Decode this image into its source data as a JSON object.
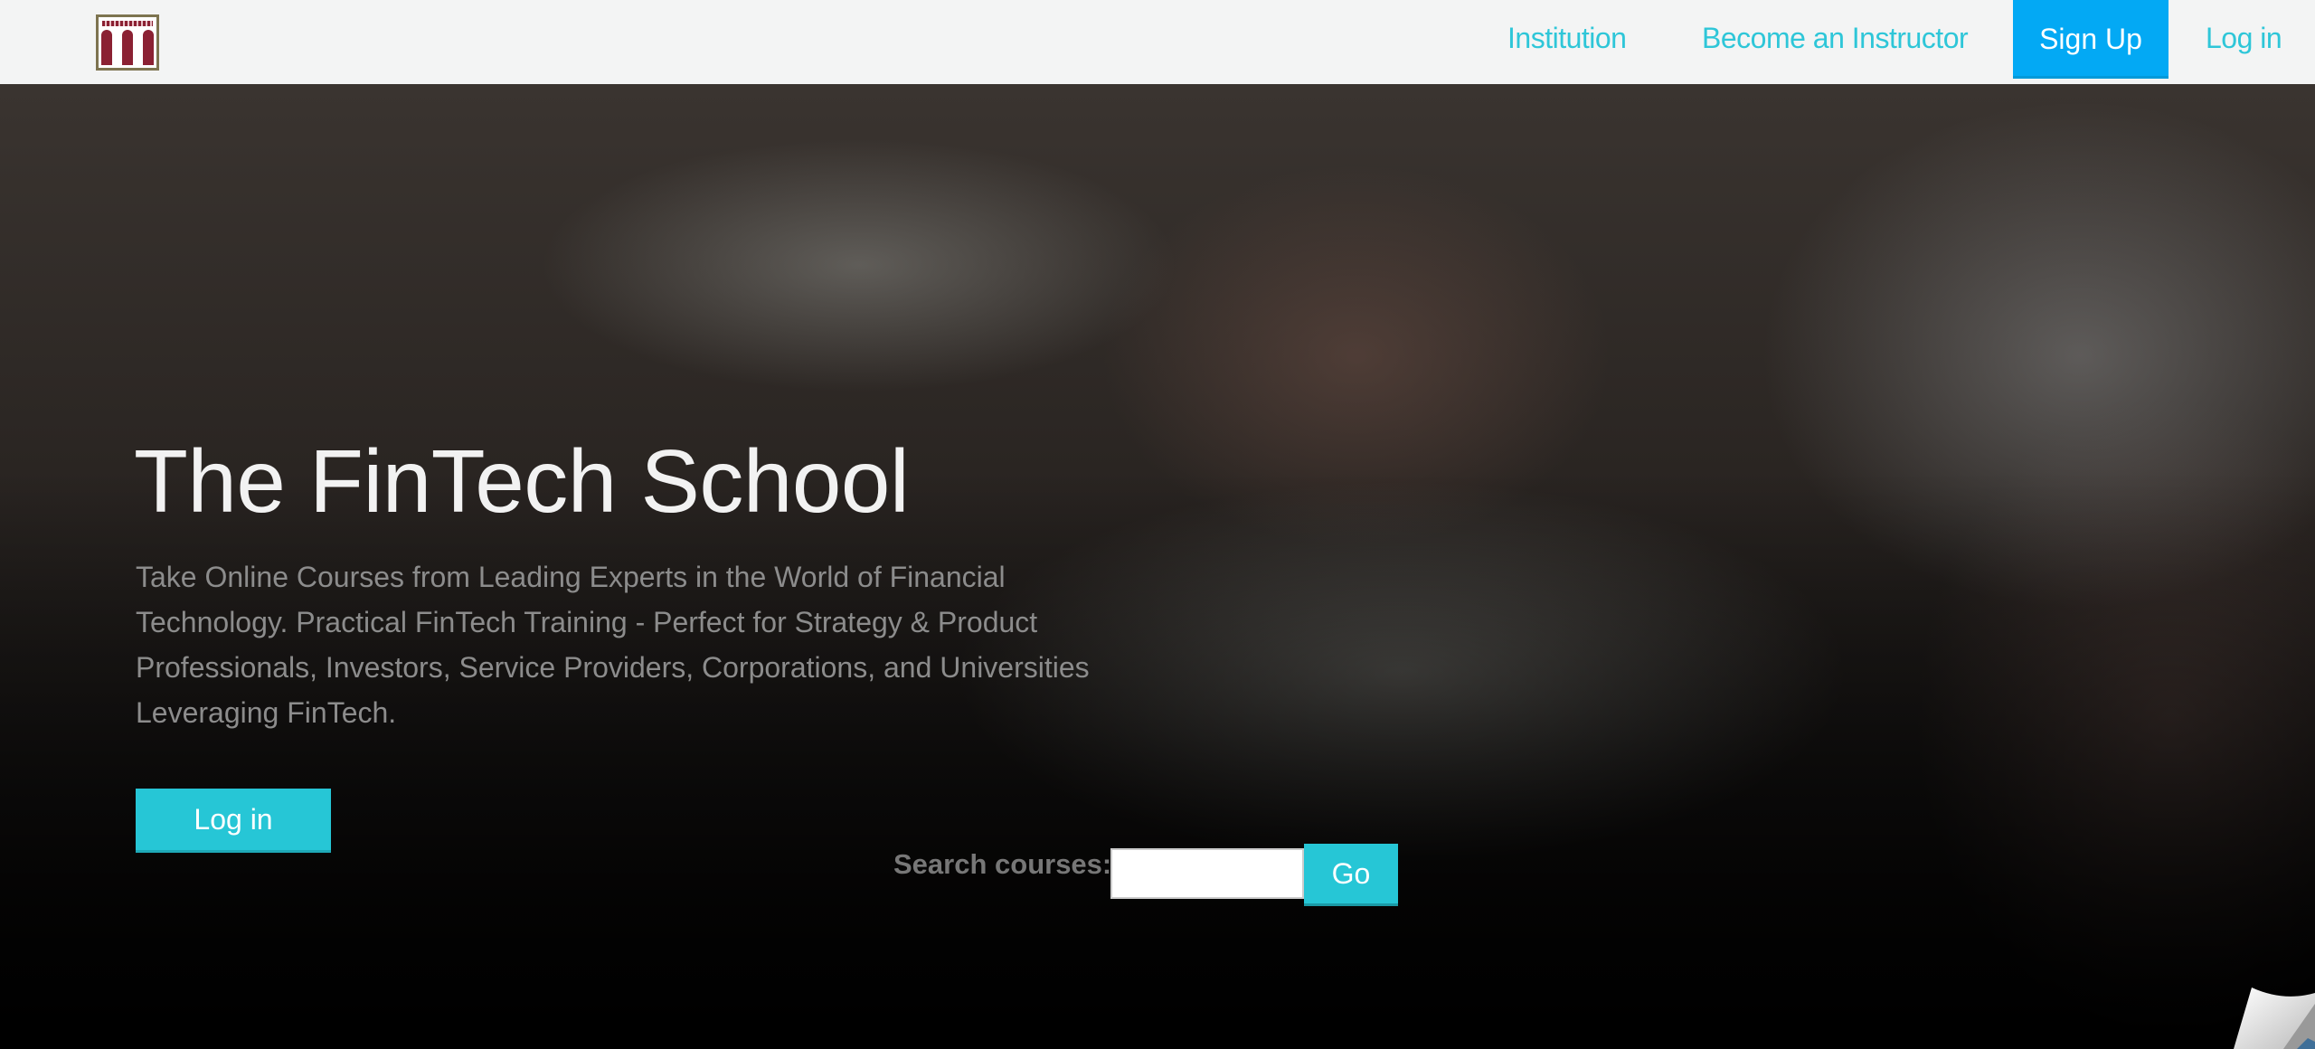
{
  "header": {
    "logo_alt": "The FinTech School logo",
    "nav": {
      "institution": "Institution",
      "become_instructor": "Become an Instructor",
      "sign_up": "Sign Up",
      "log_in": "Log in"
    }
  },
  "hero": {
    "title": "The FinTech School",
    "subtitle": "Take Online Courses from Leading Experts in the World of Financial Technology. Practical FinTech Training - Perfect for Strategy & Product Professionals, Investors, Service Providers, Corporations, and Universities Leveraging FinTech.",
    "login_button": "Log in"
  },
  "search": {
    "label": "Search courses:",
    "value": "",
    "go_button": "Go"
  },
  "colors": {
    "accent": "#26c6d6",
    "nav_link": "#2ec6d8",
    "sign_up_bg": "#03a9f4",
    "logo_red": "#8b2133"
  }
}
